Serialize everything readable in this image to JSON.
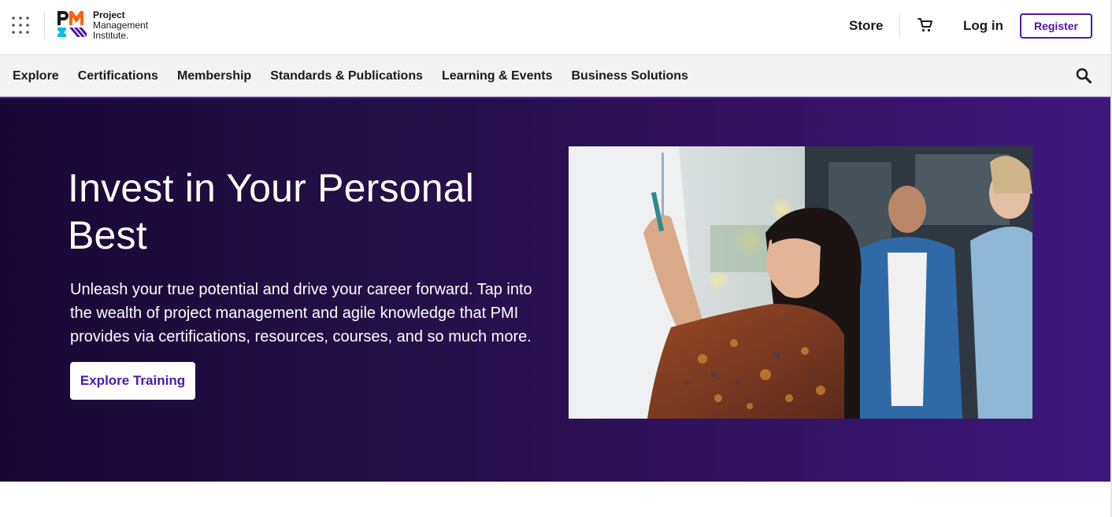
{
  "header": {
    "logo": {
      "mark_letters": "PMI",
      "line1": "Project",
      "line2": "Management",
      "line3": "Institute."
    },
    "store_label": "Store",
    "login_label": "Log in",
    "register_label": "Register",
    "icons": [
      "apps-grid-icon",
      "cart-icon"
    ]
  },
  "nav": {
    "items": [
      {
        "label": "Explore"
      },
      {
        "label": "Certifications"
      },
      {
        "label": "Membership"
      },
      {
        "label": "Standards & Publications"
      },
      {
        "label": "Learning & Events"
      },
      {
        "label": "Business Solutions"
      }
    ],
    "search_icon": "search-icon"
  },
  "hero": {
    "title": "Invest in Your Personal Best",
    "body": "Unleash your true potential and drive your career forward. Tap into the wealth of project management and agile knowledge that PMI provides via certifications, resources, courses, and so much more.",
    "cta_label": "Explore Training"
  },
  "colors": {
    "brand_purple": "#4f17a8",
    "hero_dark": "#190735",
    "hero_light": "#3c187b",
    "logo_orange": "#ff610f",
    "logo_blue": "#05bfe0"
  }
}
